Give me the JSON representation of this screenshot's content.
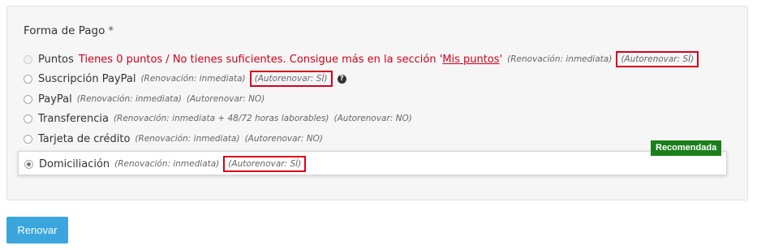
{
  "section": {
    "title": "Forma de Pago",
    "required_mark": "*"
  },
  "options": [
    {
      "label": "Puntos",
      "warning_text": "Tienes 0 puntos / No tienes suficientes. Consigue más en la sección '",
      "warning_link": "Mis puntos",
      "warning_end": "'",
      "renewal": "(Renovación: inmediata)",
      "autorenew": "(Autorenovar: SÍ)",
      "disabled": true
    },
    {
      "label": "Suscripción PayPal",
      "renewal": "(Renovación: inmediata)",
      "autorenew": "(Autorenovar: SÍ)",
      "help_icon": "question-circle-icon"
    },
    {
      "label": "PayPal",
      "renewal": "(Renovación: inmediata)",
      "autorenew": "(Autorenovar: NO)"
    },
    {
      "label": "Transferencia",
      "renewal": "(Renovación: inmediata + 48/72 horas laborables)",
      "autorenew": "(Autorenovar: NO)"
    },
    {
      "label": "Tarjeta de crédito",
      "renewal": "(Renovación: inmediata)",
      "autorenew": "(Autorenovar: NO)"
    },
    {
      "label": "Domiciliación",
      "renewal": "(Renovación: inmediata)",
      "autorenew": "(Autorenovar: SÍ)",
      "badge": "Recomendada",
      "selected": true
    }
  ],
  "help_glyph": "?",
  "submit": {
    "label": "Renovar"
  },
  "colors": {
    "accent": "#3aa6dd",
    "badge": "#1b7f1b",
    "warning": "#d0021b",
    "highlight_box": "#d9001b"
  }
}
